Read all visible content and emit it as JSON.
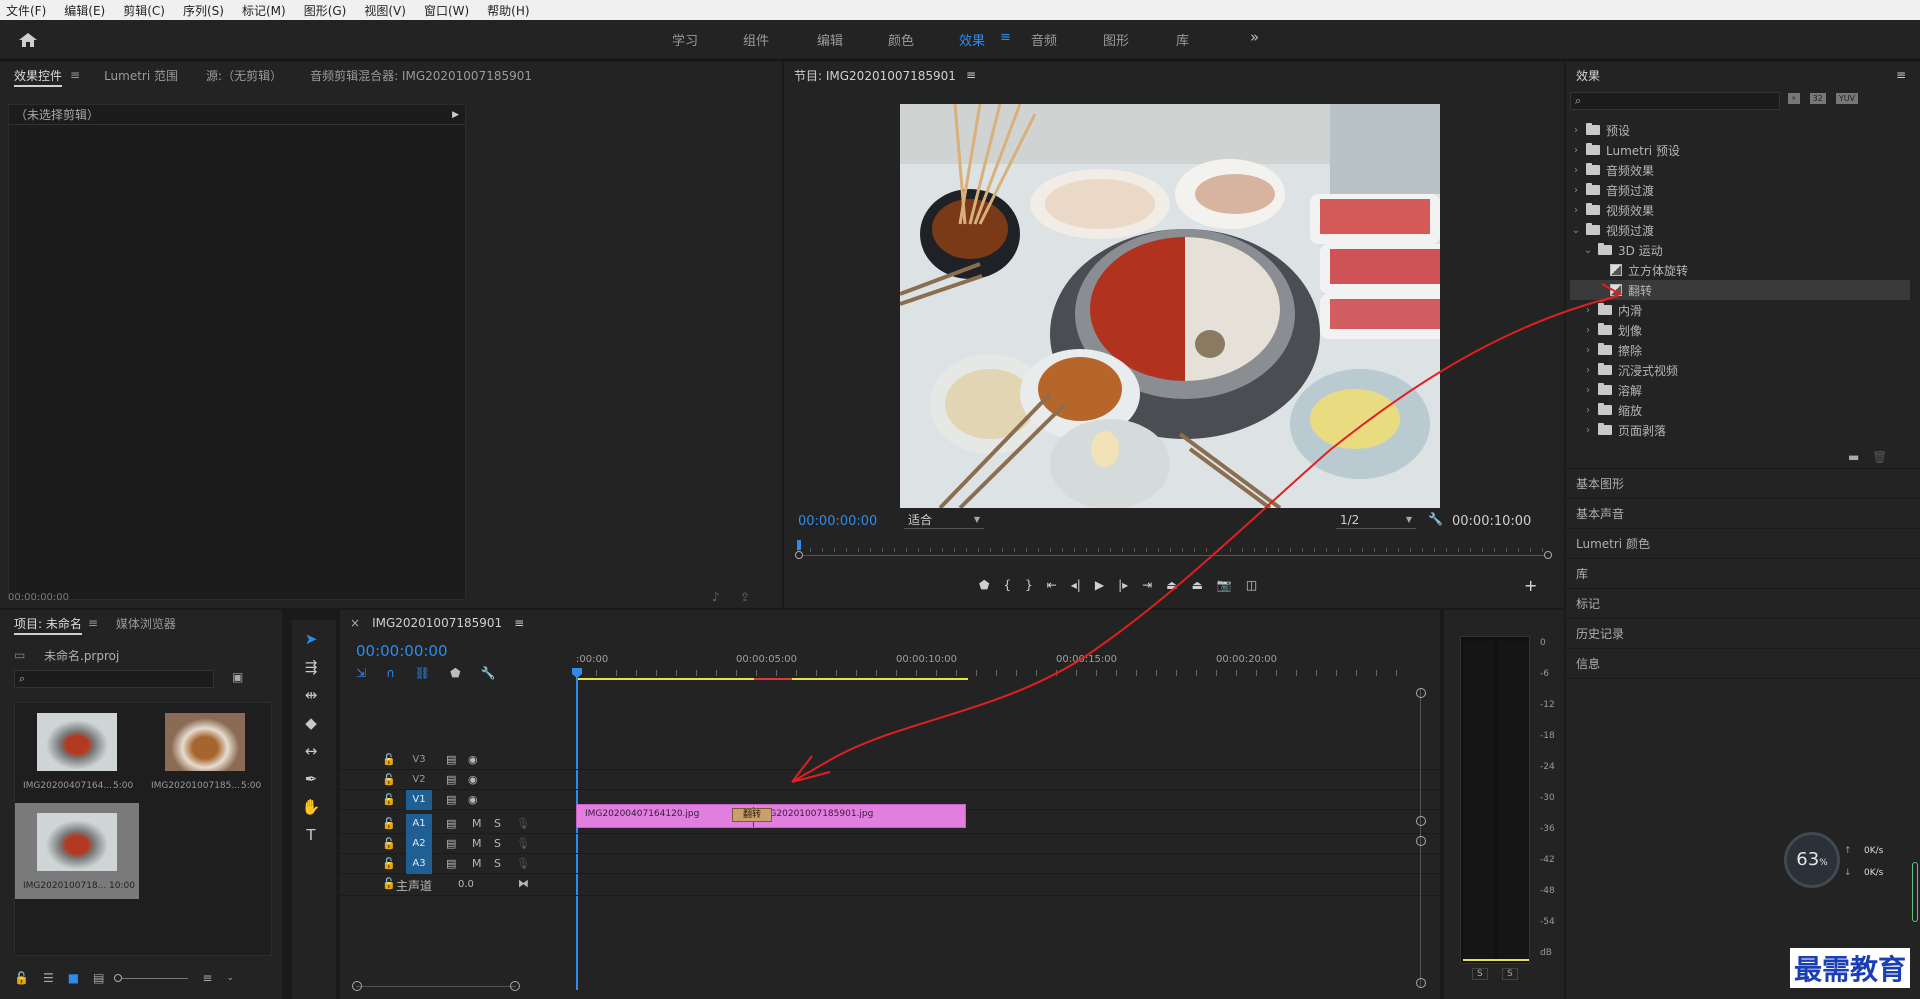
{
  "menu": [
    "文件(F)",
    "编辑(E)",
    "剪辑(C)",
    "序列(S)",
    "标记(M)",
    "图形(G)",
    "视图(V)",
    "窗口(W)",
    "帮助(H)"
  ],
  "workspaces": [
    {
      "label": "学习"
    },
    {
      "label": "组件"
    },
    {
      "label": "编辑"
    },
    {
      "label": "颜色"
    },
    {
      "label": "效果",
      "active": true
    },
    {
      "label": "音频"
    },
    {
      "label": "图形"
    },
    {
      "label": "库"
    }
  ],
  "source_panel": {
    "tabs": [
      "效果控件",
      "Lumetri 范围",
      "源:（无剪辑）",
      "音频剪辑混合器: IMG20201007185901"
    ],
    "no_clip": "（未选择剪辑）",
    "timecode": "00:00:00:00"
  },
  "program_panel": {
    "title": "节目: IMG20201007185901",
    "timecode": "00:00:00:00",
    "fit": "适合",
    "resolution": "1/2",
    "duration": "00:00:10:00"
  },
  "effects_panel": {
    "title": "效果",
    "search_placeholder": "",
    "badges": [
      "32",
      "YUV"
    ],
    "tree": [
      {
        "label": "预设",
        "level": 0,
        "type": "folder",
        "open": false
      },
      {
        "label": "Lumetri 预设",
        "level": 0,
        "type": "folder",
        "open": false
      },
      {
        "label": "音频效果",
        "level": 0,
        "type": "folder",
        "open": false
      },
      {
        "label": "音频过渡",
        "level": 0,
        "type": "folder",
        "open": false
      },
      {
        "label": "视频效果",
        "level": 0,
        "type": "folder",
        "open": false
      },
      {
        "label": "视频过渡",
        "level": 0,
        "type": "folder",
        "open": true
      },
      {
        "label": "3D 运动",
        "level": 1,
        "type": "folder",
        "open": true
      },
      {
        "label": "立方体旋转",
        "level": 2,
        "type": "fx"
      },
      {
        "label": "翻转",
        "level": 2,
        "type": "fx",
        "selected": true
      },
      {
        "label": "内滑",
        "level": 1,
        "type": "folder",
        "open": false
      },
      {
        "label": "划像",
        "level": 1,
        "type": "folder",
        "open": false
      },
      {
        "label": "擦除",
        "level": 1,
        "type": "folder",
        "open": false
      },
      {
        "label": "沉浸式视频",
        "level": 1,
        "type": "folder",
        "open": false
      },
      {
        "label": "溶解",
        "level": 1,
        "type": "folder",
        "open": false
      },
      {
        "label": "缩放",
        "level": 1,
        "type": "folder",
        "open": false
      },
      {
        "label": "页面剥落",
        "level": 1,
        "type": "folder",
        "open": false
      }
    ],
    "sections": [
      "基本图形",
      "基本声音",
      "Lumetri 颜色",
      "库",
      "标记",
      "历史记录",
      "信息"
    ]
  },
  "project_panel": {
    "tabs": [
      "项目: 未命名",
      "媒体浏览器"
    ],
    "project_file": "未命名.prproj",
    "items": [
      {
        "name": "IMG20200407164...",
        "duration": "5:00"
      },
      {
        "name": "IMG20201007185...",
        "duration": "5:00"
      },
      {
        "name": "IMG2020100718...",
        "duration": "10:00"
      }
    ]
  },
  "timeline": {
    "title": "IMG20201007185901",
    "timecode": "00:00:00:00",
    "ruler": [
      ":00:00",
      "00:00:05:00",
      "00:00:10:00",
      "00:00:15:00",
      "00:00:20:00"
    ],
    "video_tracks": [
      "V3",
      "V2",
      "V1"
    ],
    "audio_tracks": [
      "A1",
      "A2",
      "A3"
    ],
    "master": {
      "label": "主声道",
      "value": "0.0"
    },
    "track_buttons": {
      "m": "M",
      "s": "S"
    },
    "clips": [
      {
        "name": "IMG20200407164120.jpg"
      },
      {
        "name": "IMG20201007185901.jpg"
      }
    ],
    "transition": "翻转"
  },
  "meters": {
    "labels": [
      "0",
      "-6",
      "-12",
      "-18",
      "-24",
      "-30",
      "-36",
      "-42",
      "-48",
      "-54",
      "dB"
    ],
    "solo": [
      "S",
      "S"
    ]
  },
  "netwidget": {
    "percent": "63",
    "unit": "%",
    "up": "0K/s",
    "down": "0K/s"
  },
  "watermark": "最需教育"
}
